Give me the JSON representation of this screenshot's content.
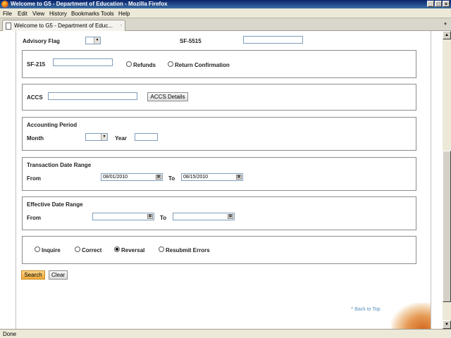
{
  "window": {
    "title": "Welcome to G5 - Department of Education - Mozilla Firefox",
    "minimize": "_",
    "maximize": "□",
    "close": "×"
  },
  "menu": [
    {
      "u": "F",
      "rest": "ile"
    },
    {
      "u": "E",
      "rest": "dit"
    },
    {
      "u": "V",
      "rest": "iew"
    },
    {
      "u": "",
      "pre": "Hi",
      "u2": "s",
      "rest": "tory"
    },
    {
      "u": "B",
      "rest": "ookmarks"
    },
    {
      "u": "T",
      "rest": "ools"
    },
    {
      "u": "H",
      "rest": "elp"
    }
  ],
  "menu_labels": [
    "File",
    "Edit",
    "View",
    "History",
    "Bookmarks",
    "Tools",
    "Help"
  ],
  "tab": {
    "title": "Welcome to G5 - Department of Educ...",
    "close": "-"
  },
  "form": {
    "advisory_flag_label": "Advisory Flag",
    "sf5515_label": "SF-5515",
    "sf215_label": "SF-215",
    "refunds_label": "Refunds",
    "return_confirmation_label": "Return Confirmation",
    "accs_label": "ACCS",
    "accs_details_button": "ACCS Details",
    "accounting_period_title": "Accounting Period",
    "month_label": "Month",
    "year_label": "Year",
    "transaction_date_range_title": "Transaction Date Range",
    "transaction_from_label": "From",
    "transaction_from_value": "08/01/2010",
    "transaction_to_label": "To",
    "transaction_to_value": "08/15/2010",
    "effective_date_range_title": "Effective Date Range",
    "effective_from_label": "From",
    "effective_to_label": "To",
    "mode_options": [
      "Inquire",
      "Correct",
      "Reversal",
      "Resubmit Errors"
    ],
    "mode_selected": "Reversal",
    "search_button": "Search",
    "clear_button": "Clear",
    "back_to_top": "^ Back to Top"
  },
  "status": {
    "text": "Done"
  }
}
